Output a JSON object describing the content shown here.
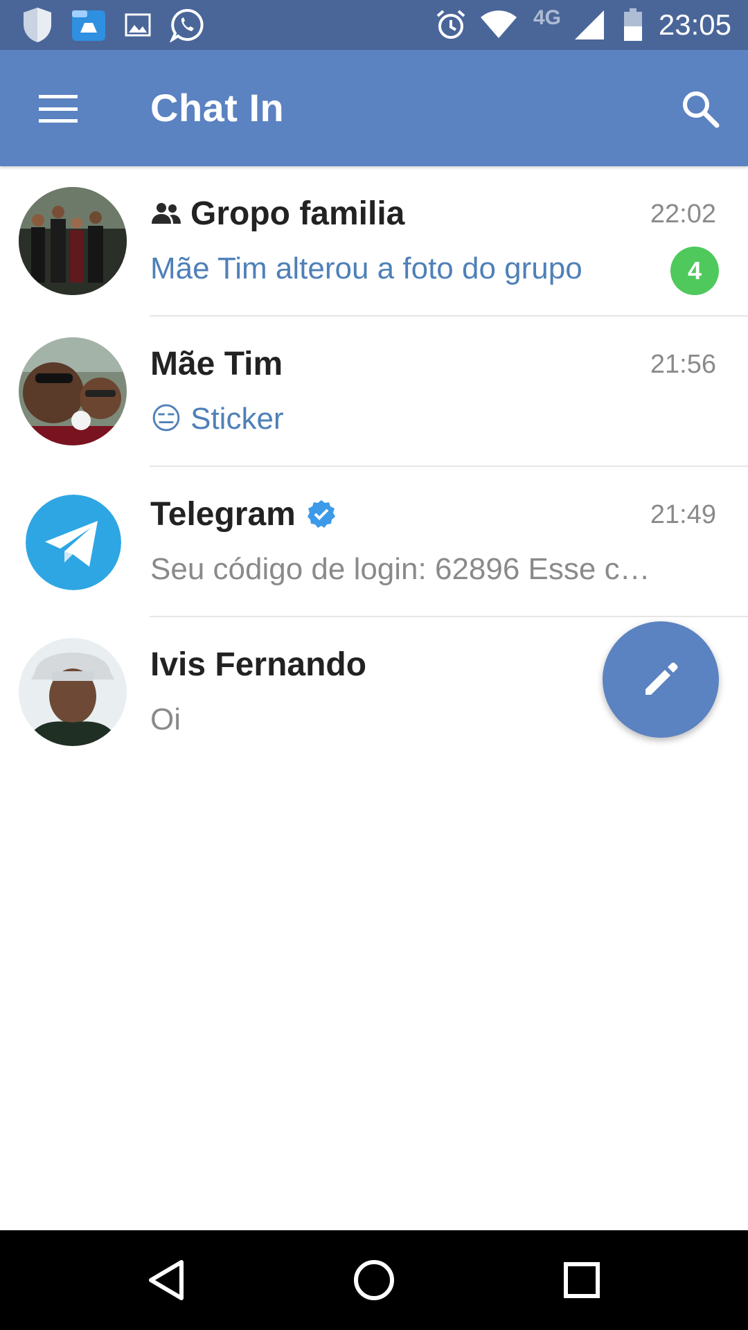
{
  "status_bar": {
    "time": "23:05",
    "network": "4G",
    "colors": {
      "background": "#4a6699"
    }
  },
  "app_bar": {
    "title": "Chat In",
    "colors": {
      "background": "#5b82c1"
    }
  },
  "chats": [
    {
      "name": "Gropo familia",
      "time": "22:02",
      "message": "Mãe Tim alterou a foto do grupo",
      "unread": "4",
      "is_group": true
    },
    {
      "name": "Mãe Tim",
      "time": "21:56",
      "message": "Sticker",
      "sticker_emoji": "😑"
    },
    {
      "name": "Telegram",
      "time": "21:49",
      "message": "Seu código de login: 62896  Esse c…",
      "verified": true
    },
    {
      "name": "Ivis Fernando",
      "time": "",
      "message": "Oi"
    }
  ],
  "icons": {
    "status": [
      "shield-icon",
      "file-manager-icon",
      "gallery-icon",
      "whatsapp-icon",
      "alarm-icon",
      "wifi-icon",
      "signal-icon",
      "battery-icon"
    ],
    "app_bar": [
      "menu-icon",
      "search-icon"
    ],
    "fab": "pencil-icon",
    "nav": [
      "back-icon",
      "home-icon",
      "recents-icon"
    ]
  },
  "colors": {
    "unread_badge": "#4fc95c",
    "message_accent": "#4f80b8",
    "fab": "#5b82c1",
    "verified": "#3d9ae8"
  }
}
